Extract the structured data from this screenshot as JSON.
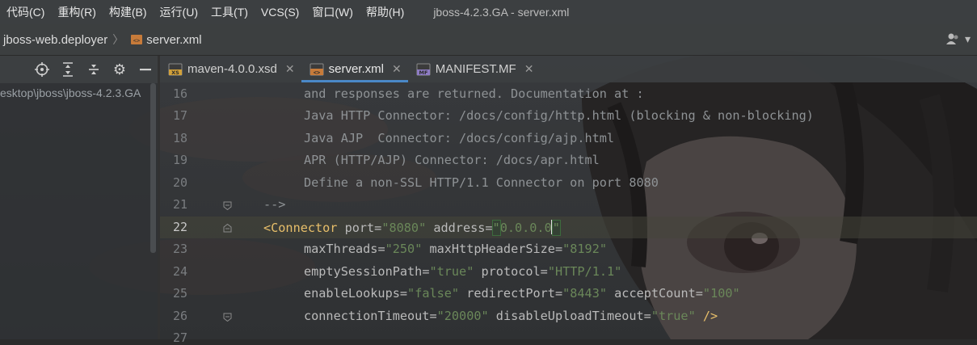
{
  "menubar": {
    "items": [
      "代码(C)",
      "重构(R)",
      "构建(B)",
      "运行(U)",
      "工具(T)",
      "VCS(S)",
      "窗口(W)",
      "帮助(H)"
    ],
    "window_title": "jboss-4.2.3.GA - server.xml"
  },
  "breadcrumb": {
    "project": "jboss-web.deployer",
    "file": "server.xml"
  },
  "project_panel": {
    "path": "esktop\\jboss\\jboss-4.2.3.GA"
  },
  "tabs": [
    {
      "label": "maven-4.0.0.xsd",
      "icon": "xsd-file-icon",
      "active": false
    },
    {
      "label": "server.xml",
      "icon": "xml-file-icon",
      "active": true
    },
    {
      "label": "MANIFEST.MF",
      "icon": "manifest-file-icon",
      "active": false
    }
  ],
  "editor": {
    "current_line": 22,
    "lines": [
      {
        "num": "16",
        "text": "and responses are returned. Documentation at :"
      },
      {
        "num": "17",
        "text": "Java HTTP Connector: /docs/config/http.html (blocking & non-blocking)"
      },
      {
        "num": "18",
        "text": "Java AJP  Connector: /docs/config/ajp.html"
      },
      {
        "num": "19",
        "text": "APR (HTTP/AJP) Connector: /docs/apr.html"
      },
      {
        "num": "20",
        "text": "Define a non-SSL HTTP/1.1 Connector on port 8080"
      },
      {
        "num": "21",
        "text": "-->"
      },
      {
        "num": "22",
        "tag": "<Connector",
        "attrs": [
          {
            "name": "port",
            "value": "8080"
          },
          {
            "name": "address",
            "value": "0.0.0.0"
          }
        ]
      },
      {
        "num": "23",
        "attrs": [
          {
            "name": "maxThreads",
            "value": "250"
          },
          {
            "name": "maxHttpHeaderSize",
            "value": "8192"
          }
        ]
      },
      {
        "num": "24",
        "attrs": [
          {
            "name": "emptySessionPath",
            "value": "true"
          },
          {
            "name": "protocol",
            "value": "HTTP/1.1"
          }
        ]
      },
      {
        "num": "25",
        "attrs": [
          {
            "name": "enableLookups",
            "value": "false"
          },
          {
            "name": "redirectPort",
            "value": "8443"
          },
          {
            "name": "acceptCount",
            "value": "100"
          }
        ]
      },
      {
        "num": "26",
        "attrs": [
          {
            "name": "connectionTimeout",
            "value": "20000"
          },
          {
            "name": "disableUploadTimeout",
            "value": "true"
          }
        ],
        "close": "/>"
      },
      {
        "num": "27",
        "text": ""
      }
    ]
  },
  "colors": {
    "tag": "#e8bf6a",
    "attr": "#bababa",
    "value": "#6a8759",
    "comment": "#8e9295",
    "active_tab_underline": "#4a88c7"
  }
}
